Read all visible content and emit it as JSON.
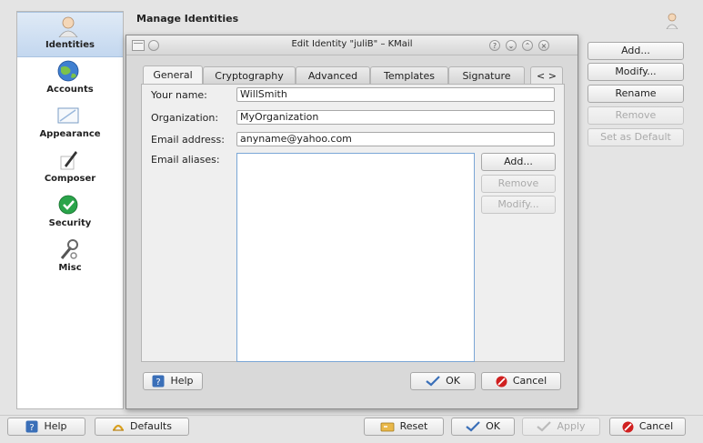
{
  "sidebar": {
    "items": [
      {
        "label": "Identities",
        "icon": "identities-icon",
        "selected": true
      },
      {
        "label": "Accounts",
        "icon": "globe-icon",
        "selected": false
      },
      {
        "label": "Appearance",
        "icon": "appearance-icon",
        "selected": false
      },
      {
        "label": "Composer",
        "icon": "pen-icon",
        "selected": false
      },
      {
        "label": "Security",
        "icon": "shield-icon",
        "selected": false
      },
      {
        "label": "Misc",
        "icon": "wrench-icon",
        "selected": false
      }
    ]
  },
  "header": {
    "title": "Manage Identities"
  },
  "identity_buttons": {
    "add": "Add...",
    "modify": "Modify...",
    "rename": "Rename",
    "remove": "Remove",
    "set_default": "Set as Default"
  },
  "dialog": {
    "title": "Edit Identity \"juliB\" – KMail",
    "tabs": [
      "General",
      "Cryptography",
      "Advanced",
      "Templates",
      "Signature"
    ],
    "tab_scroll": "< >",
    "fields": {
      "name_label": "Your name:",
      "name_value": "WillSmith",
      "org_label": "Organization:",
      "org_value": "MyOrganization",
      "email_label": "Email address:",
      "email_value": "anyname@yahoo.com",
      "aliases_label": "Email aliases:"
    },
    "alias_buttons": {
      "add": "Add...",
      "remove": "Remove",
      "modify": "Modify..."
    },
    "help": "Help",
    "ok": "OK",
    "cancel": "Cancel"
  },
  "footer": {
    "help": "Help",
    "defaults": "Defaults",
    "reset": "Reset",
    "ok": "OK",
    "apply": "Apply",
    "cancel": "Cancel"
  },
  "colors": {
    "selection": "#c3d7ef",
    "aliases_border": "#7aa6d6",
    "cancel_icon": "#d02020",
    "ok_icon": "#3a6fb8"
  }
}
